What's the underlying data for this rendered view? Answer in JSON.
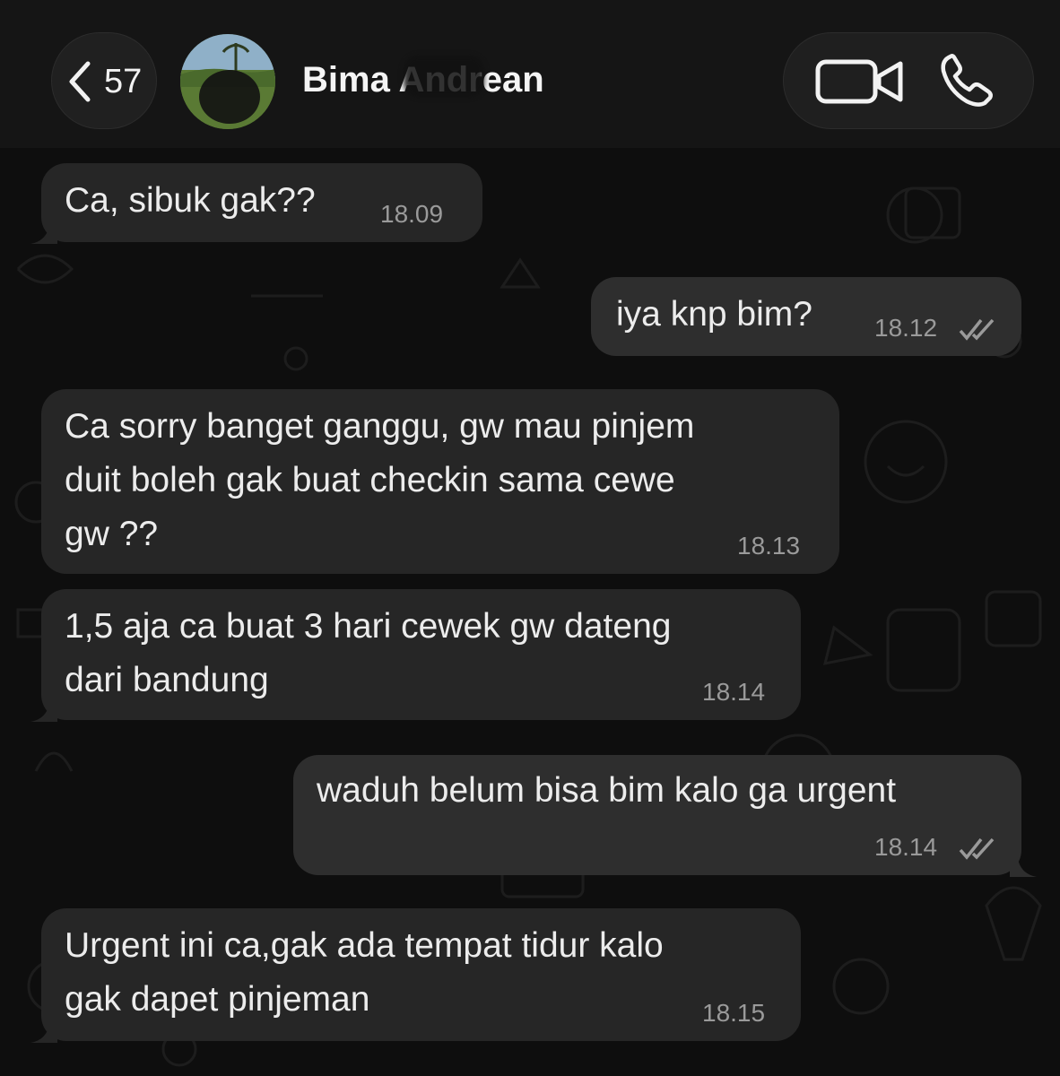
{
  "header": {
    "back_count": "57",
    "contact_name": "Bima Andrean",
    "icons": {
      "back": "chevron-left-icon",
      "video": "video-call-icon",
      "phone": "phone-call-icon"
    }
  },
  "messages": [
    {
      "direction": "in",
      "text": "Ca, sibuk gak??",
      "time": "18.09"
    },
    {
      "direction": "out",
      "text": "iya knp bim?",
      "time": "18.12",
      "status": "read"
    },
    {
      "direction": "in",
      "text": "Ca sorry banget ganggu, gw mau pinjem\nduit boleh gak buat checkin sama cewe\ngw ??",
      "time": "18.13"
    },
    {
      "direction": "in",
      "text": "1,5 aja ca buat 3 hari cewek gw dateng\ndari bandung",
      "time": "18.14"
    },
    {
      "direction": "out",
      "text": "waduh belum bisa bim kalo ga urgent",
      "time": "18.14",
      "status": "read"
    },
    {
      "direction": "in",
      "text": "Urgent ini ca,gak ada tempat tidur kalo\ngak dapet pinjeman",
      "time": "18.15"
    }
  ],
  "colors": {
    "background": "#0e0e0e",
    "header": "#151515",
    "incoming_bubble": "#262626",
    "outgoing_bubble": "#2e2e2e",
    "text": "#ececec",
    "timestamp": "#9a9a9a"
  }
}
